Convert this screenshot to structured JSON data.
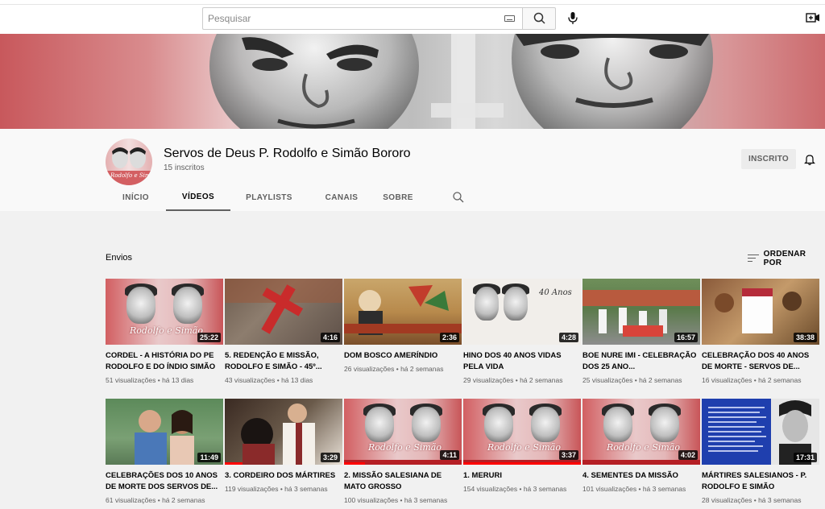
{
  "header": {
    "search_placeholder": "Pesquisar",
    "search_icon": "search-icon",
    "keyboard_icon": "keyboard-icon",
    "mic_icon": "mic-icon",
    "create_icon": "create-video-icon"
  },
  "channel": {
    "name": "Servos de Deus P. Rodolfo e Simão Bororo",
    "subscribers": "15 inscritos",
    "subscribe_label": "INSCRITO",
    "bell_icon": "bell-icon",
    "avatar_text": "Rodolfo e Simão"
  },
  "tabs": [
    {
      "label": "INÍCIO",
      "active": false
    },
    {
      "label": "VÍDEOS",
      "active": true
    },
    {
      "label": "PLAYLISTS",
      "active": false
    },
    {
      "label": "CANAIS",
      "active": false
    },
    {
      "label": "SOBRE",
      "active": false
    }
  ],
  "shelf": {
    "title": "Envios",
    "sort_label": "ORDENAR POR",
    "sort_icon": "sort-icon"
  },
  "videos": [
    {
      "title": "CORDEL - A HISTÓRIA DO PE RODOLFO E DO ÍNDIO SIMÃO",
      "views": "51 visualizações",
      "age": "há 13 dias",
      "duration": "25:22",
      "thumb_text": "Rodolfo e Simão"
    },
    {
      "title": "5. REDENÇÃO E MISSÃO, RODOLFO E SIMÃO - 45º...",
      "views": "43 visualizações",
      "age": "há 13 dias",
      "duration": "4:16"
    },
    {
      "title": "DOM BOSCO AMERÍNDIO",
      "views": "26 visualizações",
      "age": "há 2 semanas",
      "duration": "2:36"
    },
    {
      "title": "HINO DOS 40 ANOS VIDAS PELA VIDA",
      "views": "29 visualizações",
      "age": "há 2 semanas",
      "duration": "4:28",
      "thumb_text": "40 Anos"
    },
    {
      "title": "BOE NURE IMI - CELEBRAÇÃO DOS 25 ANO...",
      "views": "25 visualizações",
      "age": "há 2 semanas",
      "duration": "16:57"
    },
    {
      "title": "CELEBRAÇÃO DOS 40 ANOS DE MORTE - SERVOS DE...",
      "views": "16 visualizações",
      "age": "há 2 semanas",
      "duration": "38:38"
    },
    {
      "title": "CELEBRAÇÕES DOS 10 ANOS DE MORTE DOS SERVOS DE...",
      "views": "61 visualizações",
      "age": "há 2 semanas",
      "duration": "11:49"
    },
    {
      "title": "3. CORDEIRO DOS MÁRTIRES",
      "views": "119 visualizações",
      "age": "há 3 semanas",
      "duration": "3:29",
      "progress": 0.15
    },
    {
      "title": "2. MISSÃO SALESIANA DE MATO GROSSO",
      "views": "100 visualizações",
      "age": "há 3 semanas",
      "duration": "4:11",
      "thumb_text": "Rodolfo e Simão",
      "progress": 0.18
    },
    {
      "title": "1. MERURI",
      "views": "154 visualizações",
      "age": "há 3 semanas",
      "duration": "3:37",
      "thumb_text": "Rodolfo e Simão",
      "progress": 1.0
    },
    {
      "title": "4. SEMENTES DA MISSÃO",
      "views": "101 visualizações",
      "age": "há 3 semanas",
      "duration": "4:02",
      "thumb_text": "Rodolfo e Simão"
    },
    {
      "title": "MÁRTIRES SALESIANOS - P. RODOLFO E SIMÃO",
      "views": "28 visualizações",
      "age": "há 3 semanas",
      "duration": "17:31"
    }
  ]
}
